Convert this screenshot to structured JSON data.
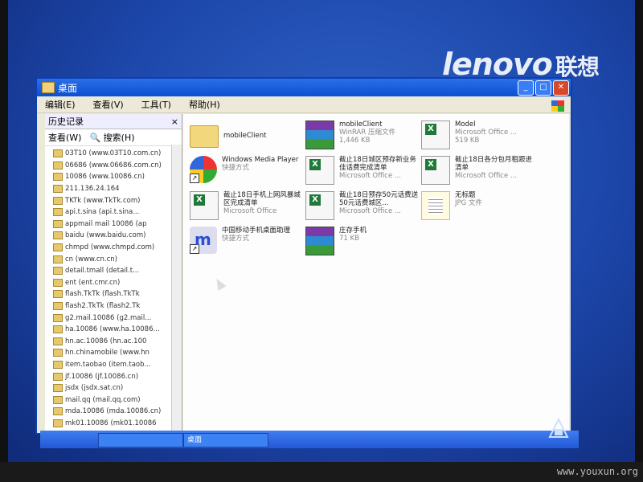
{
  "brand": {
    "logo_text": "lenovo",
    "logo_cn": "联想"
  },
  "watermark": "www.youxun.org",
  "window": {
    "title": "桌面",
    "menu": [
      "编辑(E)",
      "查看(V)",
      "工具(T)",
      "帮助(H)"
    ]
  },
  "history_pane": {
    "title": "历史记录",
    "close_label": "×",
    "view_label": "查看(W)",
    "search_label": "搜索(H)",
    "items": [
      "03T10 (www.03T10.com.cn)",
      "06686 (www.06686.com.cn)",
      "10086 (www.10086.cn)",
      "211.136.24.164",
      "TKTk (www.TkTk.com)",
      "api.t.sina (api.t.sina...",
      "appmail mail 10086 (ap",
      "baidu (www.baidu.com)",
      "chmpd (www.chmpd.com)",
      "cn (www.cn.cn)",
      "detail.tmall (detail.t...",
      "ent (ent.cmr.cn)",
      "flash.TkTk (flash.TkTk",
      "flash2.TkTk (flash2.Tk",
      "g2.mail.10086 (g2.mail...",
      "ha.10086 (www.ha.10086...",
      "hn.ac.10086 (hn.ac.100",
      "hn.chinamobile (www.hn",
      "item.taobao (item.taob...",
      "jf.10086 (jf.10086.cn)",
      "jsdx (jsdx.sat.cn)",
      "mail.qq (mail.qq.com)",
      "mda.10086 (mda.10086.cn)",
      "mk01.10086 (mk01.10086"
    ]
  },
  "files": [
    {
      "name": "mobileClient",
      "sub1": "",
      "sub2": "",
      "icon": "folder-icon"
    },
    {
      "name": "mobileClient",
      "sub1": "WinRAR 压缩文件",
      "sub2": "1,446 KB",
      "icon": "winrar-icon"
    },
    {
      "name": "Model",
      "sub1": "Microsoft Office ...",
      "sub2": "519 KB",
      "icon": "excel-icon"
    },
    {
      "name": "Windows Media Player",
      "sub1": "快捷方式",
      "sub2": "",
      "icon": "media-player-icon"
    },
    {
      "name": "截止18日城区预存新业务佳话费完成清单",
      "sub1": "Microsoft Office ...",
      "sub2": "",
      "icon": "excel-icon"
    },
    {
      "name": "截止18日各分包月租跟进清单",
      "sub1": "Microsoft Office ...",
      "sub2": "",
      "icon": "excel-icon"
    },
    {
      "name": "截止18日手机上网风暴城区完成清单",
      "sub1": "Microsoft Office",
      "sub2": "",
      "icon": "excel-icon"
    },
    {
      "name": "截止18日预存50元话费送50元话费城区...",
      "sub1": "Microsoft Office ...",
      "sub2": "",
      "icon": "excel-icon"
    },
    {
      "name": "无标题",
      "sub1": "JPG 文件",
      "sub2": "",
      "icon": "text-file-icon"
    },
    {
      "name": "中国移动手机桌面助理",
      "sub1": "快捷方式",
      "sub2": "",
      "icon": "mm-app-icon"
    },
    {
      "name": "庄存手机",
      "sub1": "71 KB",
      "sub2": "",
      "icon": "winrar-icon"
    }
  ],
  "taskbar": {
    "tasks": [
      "",
      "桌面"
    ]
  }
}
